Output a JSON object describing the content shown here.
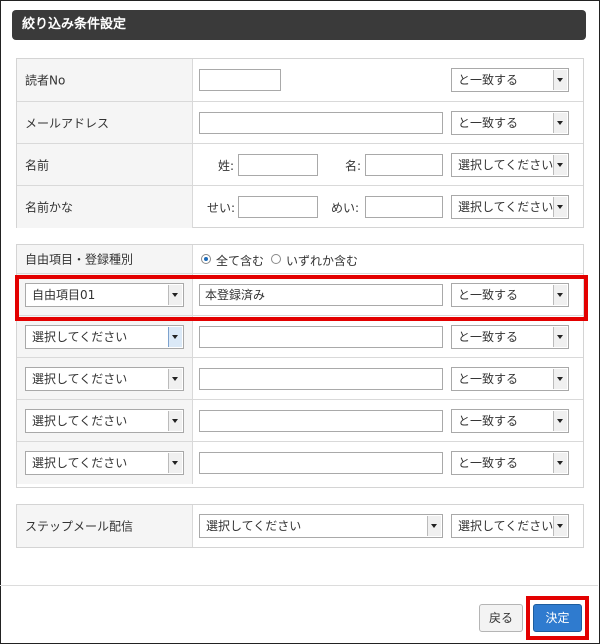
{
  "title": "絞り込み条件設定",
  "match_options": {
    "exact": "と一致する",
    "select": "選択してください"
  },
  "basic": {
    "reader_no": "読者No",
    "email": "メールアドレス",
    "name": "名前",
    "name_kana": "名前かな",
    "sei": "姓:",
    "mei": "名:",
    "sei_kana": "せい:",
    "mei_kana": "めい:"
  },
  "free": {
    "header": "自由項目・登録種別",
    "radio_all": "全て含む",
    "radio_any": "いずれか含む",
    "rows": [
      {
        "field": "自由項目01",
        "value": "本登録済み",
        "match": "と一致する"
      },
      {
        "field": "選択してください",
        "value": "",
        "match": "と一致する"
      },
      {
        "field": "選択してください",
        "value": "",
        "match": "と一致する"
      },
      {
        "field": "選択してください",
        "value": "",
        "match": "と一致する"
      },
      {
        "field": "選択してください",
        "value": "",
        "match": "と一致する"
      }
    ]
  },
  "step": {
    "label": "ステップメール配信",
    "select": "選択してください",
    "match": "選択してください"
  },
  "buttons": {
    "back": "戻る",
    "ok": "決定"
  }
}
